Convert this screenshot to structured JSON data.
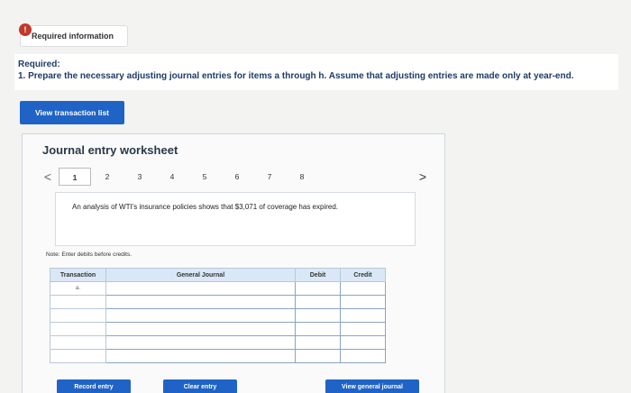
{
  "info": {
    "alert": "!",
    "title": "Required information"
  },
  "required": {
    "heading": "Required:",
    "text": "1. Prepare the necessary adjusting journal entries for items a through h. Assume that adjusting entries are made only at year-end."
  },
  "buttons": {
    "view_transaction_list": "View transaction list",
    "record_entry": "Record entry",
    "clear_entry": "Clear entry",
    "view_general_journal": "View general journal"
  },
  "worksheet": {
    "title": "Journal entry worksheet",
    "pages": [
      "1",
      "2",
      "3",
      "4",
      "5",
      "6",
      "7",
      "8"
    ],
    "active_page": "1",
    "prev_arrow": "<",
    "next_arrow": ">",
    "analysis": "An analysis of WTI's insurance policies shows that $3,071 of coverage has expired.",
    "note": "Note: Enter debits before credits."
  },
  "table": {
    "headers": [
      "Transaction",
      "General Journal",
      "Debit",
      "Credit"
    ],
    "transaction_label": "a."
  }
}
